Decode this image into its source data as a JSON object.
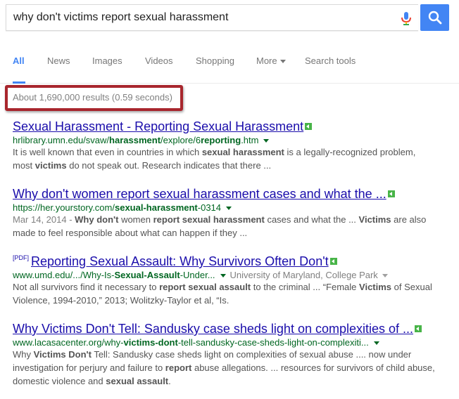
{
  "search": {
    "query": "why don't victims report sexual harassment"
  },
  "tabs": [
    {
      "label": "All",
      "active": true
    },
    {
      "label": "News"
    },
    {
      "label": "Images"
    },
    {
      "label": "Videos"
    },
    {
      "label": "Shopping"
    },
    {
      "label": "More"
    },
    {
      "label": "Search tools"
    }
  ],
  "stats": "About 1,690,000 results (0.59 seconds)",
  "colors": {
    "accent": "#4285f4",
    "title_link": "#1a0dab",
    "url_green": "#006621",
    "highlight_box": "#a8262d"
  },
  "icons": [
    "mic-icon",
    "search-icon",
    "caret-down-icon",
    "cached-badge-icon"
  ],
  "results": [
    {
      "title": "Sexual Harassment - Reporting Sexual Harassment",
      "url_parts": [
        "hrlibrary.umn.edu/svaw/",
        "harassment",
        "/explore/6",
        "reporting",
        ".htm"
      ],
      "snippet": [
        "It is well known that even in countries in which ",
        "sexual harassment",
        " is a legally-recognized problem, most ",
        "victims",
        " do not speak out. Research indicates that there ..."
      ]
    },
    {
      "title": "Why don't women report sexual harassment cases and what the ...",
      "url_parts": [
        "https://her.yourstory.com/",
        "sexual-harassment",
        "-0314"
      ],
      "date": "Mar 14, 2014 - ",
      "snippet": [
        "Why don't",
        " women ",
        "report sexual harassment",
        " cases and what the ... ",
        "Victims",
        " are also made to feel responsible about what can happen if they ..."
      ]
    },
    {
      "pdf_tag": "[PDF]",
      "title": "Reporting Sexual Assault: Why Survivors Often Don't",
      "url_parts": [
        "www.umd.edu/.../Why-Is-",
        "Sexual-Assault",
        "-Under..."
      ],
      "source": "University of Maryland, College Park",
      "snippet": [
        "Not all survivors find it necessary to ",
        "report sexual assault",
        " to the criminal ... “Female ",
        "Victims",
        " of Sexual Violence, 1994-2010,” 2013; Wolitzky-Taylor et al, “Is."
      ]
    },
    {
      "title": "Why Victims Don't Tell: Sandusky case sheds light on complexities of ...",
      "url_parts": [
        "www.lacasacenter.org/why-",
        "victims-dont",
        "-tell-sandusky-case-sheds-light-on-complexiti..."
      ],
      "snippet": [
        "Why ",
        "Victims Don't",
        " Tell: Sandusky case sheds light on complexities of sexual abuse .... now under investigation for perjury and failure to ",
        "report",
        " abuse allegations. ... resources for survivors of child abuse, domestic violence and ",
        "sexual assault",
        "."
      ]
    }
  ]
}
